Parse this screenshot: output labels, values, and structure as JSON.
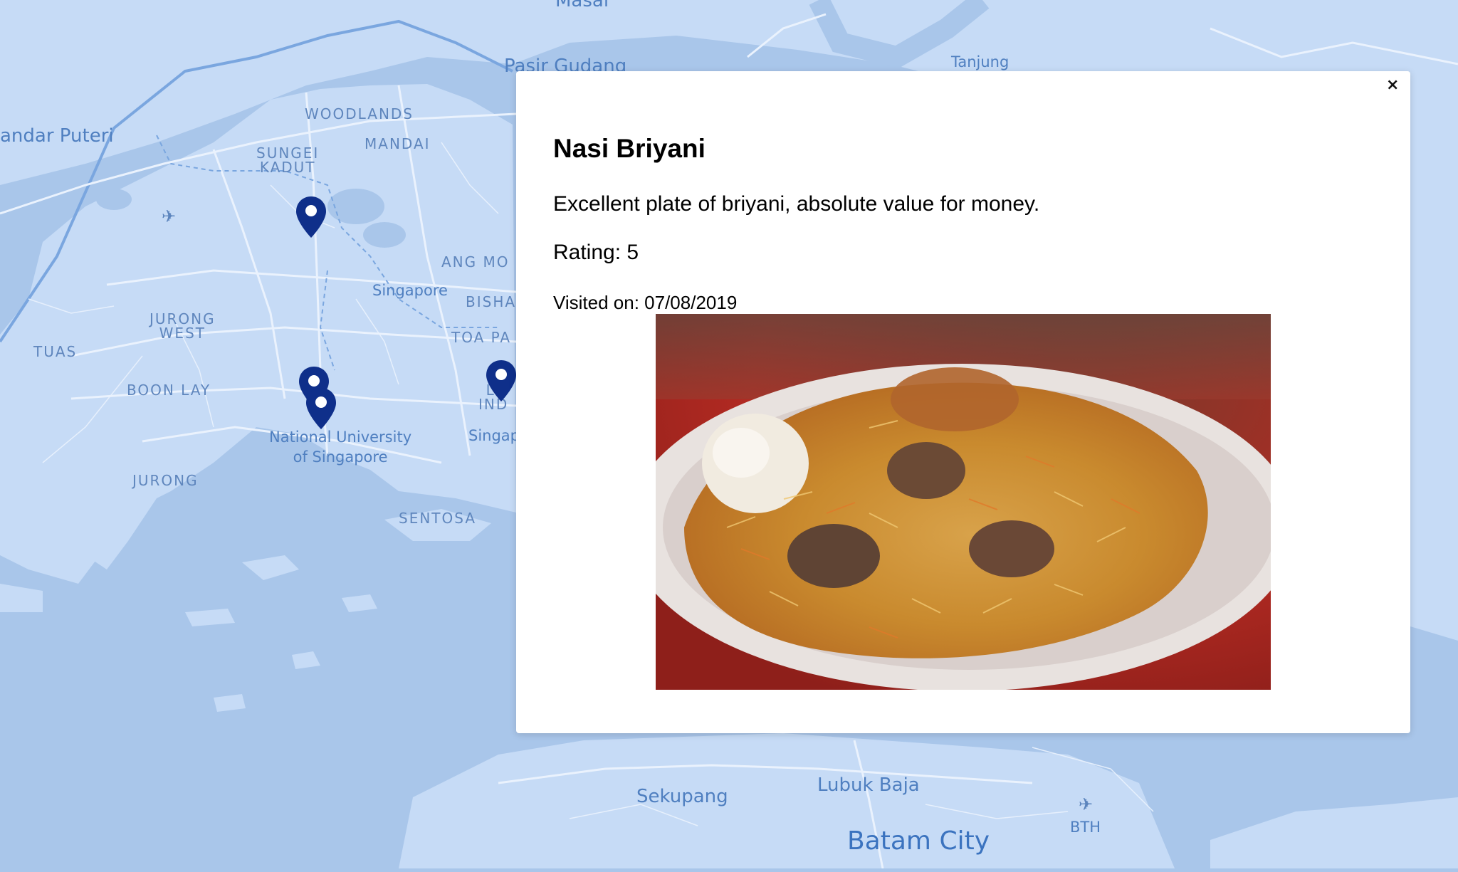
{
  "map": {
    "labels": {
      "masai": "Masai",
      "pasir_gudang": "Pasir Gudang",
      "tanjung": "Tanjung",
      "bandar_puteri": "andar Puteri",
      "woodlands": "WOODLANDS",
      "mandai": "MANDAI",
      "sungei_kadut": "SUNGEI\nKADUT",
      "ang_mo": "ANG MO",
      "singapore": "Singapore",
      "bisha": "BISHA",
      "toa_pa": "TOA PA",
      "jurong_west": "JURONG\nWEST",
      "tuas": "TUAS",
      "boon_lay": "BOON LAY",
      "lind": "LI\nIND",
      "singap": "Singap",
      "nus": "National University\nof Singapore",
      "jurong": "JURONG",
      "sentosa": "SENTOSA",
      "sekupang": "Sekupang",
      "lubuk_baja": "Lubuk Baja",
      "batam_city": "Batam City",
      "bth": "BTH"
    },
    "colors": {
      "water": "#a9c6ea",
      "land": "#c6dbf6",
      "roads": "#eaf2fd",
      "marker": "#0f2f8a"
    }
  },
  "modal": {
    "close_label": "×",
    "title": "Nasi Briyani",
    "description": "Excellent plate of briyani, absolute value for money.",
    "rating": "Rating: 5",
    "visited": "Visited on: 07/08/2019"
  },
  "icons": {
    "marker": "map-marker-icon",
    "airport": "airport-icon",
    "close": "close-icon"
  }
}
